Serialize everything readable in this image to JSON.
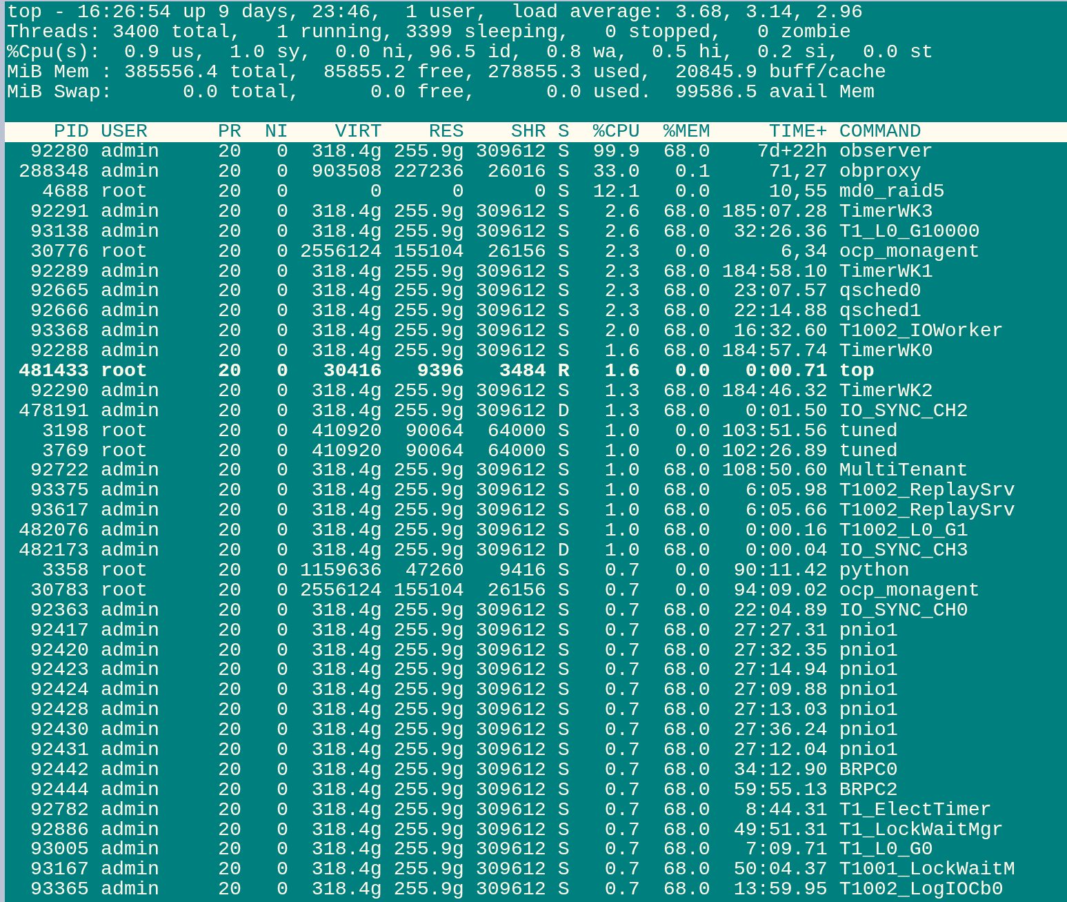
{
  "summary": [
    "top - 16:26:54 up 9 days, 23:46,  1 user,  load average: 3.68, 3.14, 2.96",
    "Threads: 3400 total,   1 running, 3399 sleeping,   0 stopped,   0 zombie",
    "%Cpu(s):  0.9 us,  1.0 sy,  0.0 ni, 96.5 id,  0.8 wa,  0.5 hi,  0.2 si,  0.0 st",
    "MiB Mem : 385556.4 total,  85855.2 free, 278855.3 used,  20845.9 buff/cache",
    "MiB Swap:      0.0 total,      0.0 free,      0.0 used.  99586.5 avail Mem"
  ],
  "columns": [
    "PID",
    "USER",
    "PR",
    "NI",
    "VIRT",
    "RES",
    "SHR",
    "S",
    "%CPU",
    "%MEM",
    "TIME+",
    "COMMAND"
  ],
  "rows": [
    {
      "cells": [
        "92280",
        "admin",
        "20",
        "0",
        "318.4g",
        "255.9g",
        "309612",
        "S",
        "99.9",
        "68.0",
        "7d+22h",
        "observer"
      ],
      "highlighted": false
    },
    {
      "cells": [
        "288348",
        "admin",
        "20",
        "0",
        "903508",
        "227236",
        "26016",
        "S",
        "33.0",
        "0.1",
        "71,27",
        "obproxy"
      ],
      "highlighted": false
    },
    {
      "cells": [
        "4688",
        "root",
        "20",
        "0",
        "0",
        "0",
        "0",
        "S",
        "12.1",
        "0.0",
        "10,55",
        "md0_raid5"
      ],
      "highlighted": false
    },
    {
      "cells": [
        "92291",
        "admin",
        "20",
        "0",
        "318.4g",
        "255.9g",
        "309612",
        "S",
        "2.6",
        "68.0",
        "185:07.28",
        "TimerWK3"
      ],
      "highlighted": false
    },
    {
      "cells": [
        "93138",
        "admin",
        "20",
        "0",
        "318.4g",
        "255.9g",
        "309612",
        "S",
        "2.6",
        "68.0",
        "32:26.36",
        "T1_L0_G10000"
      ],
      "highlighted": false
    },
    {
      "cells": [
        "30776",
        "root",
        "20",
        "0",
        "2556124",
        "155104",
        "26156",
        "S",
        "2.3",
        "0.0",
        "6,34",
        "ocp_monagent"
      ],
      "highlighted": false
    },
    {
      "cells": [
        "92289",
        "admin",
        "20",
        "0",
        "318.4g",
        "255.9g",
        "309612",
        "S",
        "2.3",
        "68.0",
        "184:58.10",
        "TimerWK1"
      ],
      "highlighted": false
    },
    {
      "cells": [
        "92665",
        "admin",
        "20",
        "0",
        "318.4g",
        "255.9g",
        "309612",
        "S",
        "2.3",
        "68.0",
        "23:07.57",
        "qsched0"
      ],
      "highlighted": false
    },
    {
      "cells": [
        "92666",
        "admin",
        "20",
        "0",
        "318.4g",
        "255.9g",
        "309612",
        "S",
        "2.3",
        "68.0",
        "22:14.88",
        "qsched1"
      ],
      "highlighted": false
    },
    {
      "cells": [
        "93368",
        "admin",
        "20",
        "0",
        "318.4g",
        "255.9g",
        "309612",
        "S",
        "2.0",
        "68.0",
        "16:32.60",
        "T1002_IOWorker"
      ],
      "highlighted": false
    },
    {
      "cells": [
        "92288",
        "admin",
        "20",
        "0",
        "318.4g",
        "255.9g",
        "309612",
        "S",
        "1.6",
        "68.0",
        "184:57.74",
        "TimerWK0"
      ],
      "highlighted": false
    },
    {
      "cells": [
        "481433",
        "root",
        "20",
        "0",
        "30416",
        "9396",
        "3484",
        "R",
        "1.6",
        "0.0",
        "0:00.71",
        "top"
      ],
      "highlighted": true
    },
    {
      "cells": [
        "92290",
        "admin",
        "20",
        "0",
        "318.4g",
        "255.9g",
        "309612",
        "S",
        "1.3",
        "68.0",
        "184:46.32",
        "TimerWK2"
      ],
      "highlighted": false
    },
    {
      "cells": [
        "478191",
        "admin",
        "20",
        "0",
        "318.4g",
        "255.9g",
        "309612",
        "D",
        "1.3",
        "68.0",
        "0:01.50",
        "IO_SYNC_CH2"
      ],
      "highlighted": false
    },
    {
      "cells": [
        "3198",
        "root",
        "20",
        "0",
        "410920",
        "90064",
        "64000",
        "S",
        "1.0",
        "0.0",
        "103:51.56",
        "tuned"
      ],
      "highlighted": false
    },
    {
      "cells": [
        "3769",
        "root",
        "20",
        "0",
        "410920",
        "90064",
        "64000",
        "S",
        "1.0",
        "0.0",
        "102:26.89",
        "tuned"
      ],
      "highlighted": false
    },
    {
      "cells": [
        "92722",
        "admin",
        "20",
        "0",
        "318.4g",
        "255.9g",
        "309612",
        "S",
        "1.0",
        "68.0",
        "108:50.60",
        "MultiTenant"
      ],
      "highlighted": false
    },
    {
      "cells": [
        "93375",
        "admin",
        "20",
        "0",
        "318.4g",
        "255.9g",
        "309612",
        "S",
        "1.0",
        "68.0",
        "6:05.98",
        "T1002_ReplaySrv"
      ],
      "highlighted": false
    },
    {
      "cells": [
        "93617",
        "admin",
        "20",
        "0",
        "318.4g",
        "255.9g",
        "309612",
        "S",
        "1.0",
        "68.0",
        "6:05.66",
        "T1002_ReplaySrv"
      ],
      "highlighted": false
    },
    {
      "cells": [
        "482076",
        "admin",
        "20",
        "0",
        "318.4g",
        "255.9g",
        "309612",
        "S",
        "1.0",
        "68.0",
        "0:00.16",
        "T1002_L0_G1"
      ],
      "highlighted": false
    },
    {
      "cells": [
        "482173",
        "admin",
        "20",
        "0",
        "318.4g",
        "255.9g",
        "309612",
        "D",
        "1.0",
        "68.0",
        "0:00.04",
        "IO_SYNC_CH3"
      ],
      "highlighted": false
    },
    {
      "cells": [
        "3358",
        "root",
        "20",
        "0",
        "1159636",
        "47260",
        "9416",
        "S",
        "0.7",
        "0.0",
        "90:11.42",
        "python"
      ],
      "highlighted": false
    },
    {
      "cells": [
        "30783",
        "root",
        "20",
        "0",
        "2556124",
        "155104",
        "26156",
        "S",
        "0.7",
        "0.0",
        "94:09.02",
        "ocp_monagent"
      ],
      "highlighted": false
    },
    {
      "cells": [
        "92363",
        "admin",
        "20",
        "0",
        "318.4g",
        "255.9g",
        "309612",
        "S",
        "0.7",
        "68.0",
        "22:04.89",
        "IO_SYNC_CH0"
      ],
      "highlighted": false
    },
    {
      "cells": [
        "92417",
        "admin",
        "20",
        "0",
        "318.4g",
        "255.9g",
        "309612",
        "S",
        "0.7",
        "68.0",
        "27:27.31",
        "pnio1"
      ],
      "highlighted": false
    },
    {
      "cells": [
        "92420",
        "admin",
        "20",
        "0",
        "318.4g",
        "255.9g",
        "309612",
        "S",
        "0.7",
        "68.0",
        "27:32.35",
        "pnio1"
      ],
      "highlighted": false
    },
    {
      "cells": [
        "92423",
        "admin",
        "20",
        "0",
        "318.4g",
        "255.9g",
        "309612",
        "S",
        "0.7",
        "68.0",
        "27:14.94",
        "pnio1"
      ],
      "highlighted": false
    },
    {
      "cells": [
        "92424",
        "admin",
        "20",
        "0",
        "318.4g",
        "255.9g",
        "309612",
        "S",
        "0.7",
        "68.0",
        "27:09.88",
        "pnio1"
      ],
      "highlighted": false
    },
    {
      "cells": [
        "92428",
        "admin",
        "20",
        "0",
        "318.4g",
        "255.9g",
        "309612",
        "S",
        "0.7",
        "68.0",
        "27:13.03",
        "pnio1"
      ],
      "highlighted": false
    },
    {
      "cells": [
        "92430",
        "admin",
        "20",
        "0",
        "318.4g",
        "255.9g",
        "309612",
        "S",
        "0.7",
        "68.0",
        "27:36.24",
        "pnio1"
      ],
      "highlighted": false
    },
    {
      "cells": [
        "92431",
        "admin",
        "20",
        "0",
        "318.4g",
        "255.9g",
        "309612",
        "S",
        "0.7",
        "68.0",
        "27:12.04",
        "pnio1"
      ],
      "highlighted": false
    },
    {
      "cells": [
        "92442",
        "admin",
        "20",
        "0",
        "318.4g",
        "255.9g",
        "309612",
        "S",
        "0.7",
        "68.0",
        "34:12.90",
        "BRPC0"
      ],
      "highlighted": false
    },
    {
      "cells": [
        "92444",
        "admin",
        "20",
        "0",
        "318.4g",
        "255.9g",
        "309612",
        "S",
        "0.7",
        "68.0",
        "59:55.13",
        "BRPC2"
      ],
      "highlighted": false
    },
    {
      "cells": [
        "92782",
        "admin",
        "20",
        "0",
        "318.4g",
        "255.9g",
        "309612",
        "S",
        "0.7",
        "68.0",
        "8:44.31",
        "T1_ElectTimer"
      ],
      "highlighted": false
    },
    {
      "cells": [
        "92886",
        "admin",
        "20",
        "0",
        "318.4g",
        "255.9g",
        "309612",
        "S",
        "0.7",
        "68.0",
        "49:51.31",
        "T1_LockWaitMgr"
      ],
      "highlighted": false
    },
    {
      "cells": [
        "93005",
        "admin",
        "20",
        "0",
        "318.4g",
        "255.9g",
        "309612",
        "S",
        "0.7",
        "68.0",
        "7:09.71",
        "T1_L0_G0"
      ],
      "highlighted": false
    },
    {
      "cells": [
        "93167",
        "admin",
        "20",
        "0",
        "318.4g",
        "255.9g",
        "309612",
        "S",
        "0.7",
        "68.0",
        "50:04.37",
        "T1001_LockWaitM"
      ],
      "highlighted": false
    },
    {
      "cells": [
        "93365",
        "admin",
        "20",
        "0",
        "318.4g",
        "255.9g",
        "309612",
        "S",
        "0.7",
        "68.0",
        "13:59.95",
        "T1002_LogIOCb0"
      ],
      "highlighted": false
    }
  ]
}
